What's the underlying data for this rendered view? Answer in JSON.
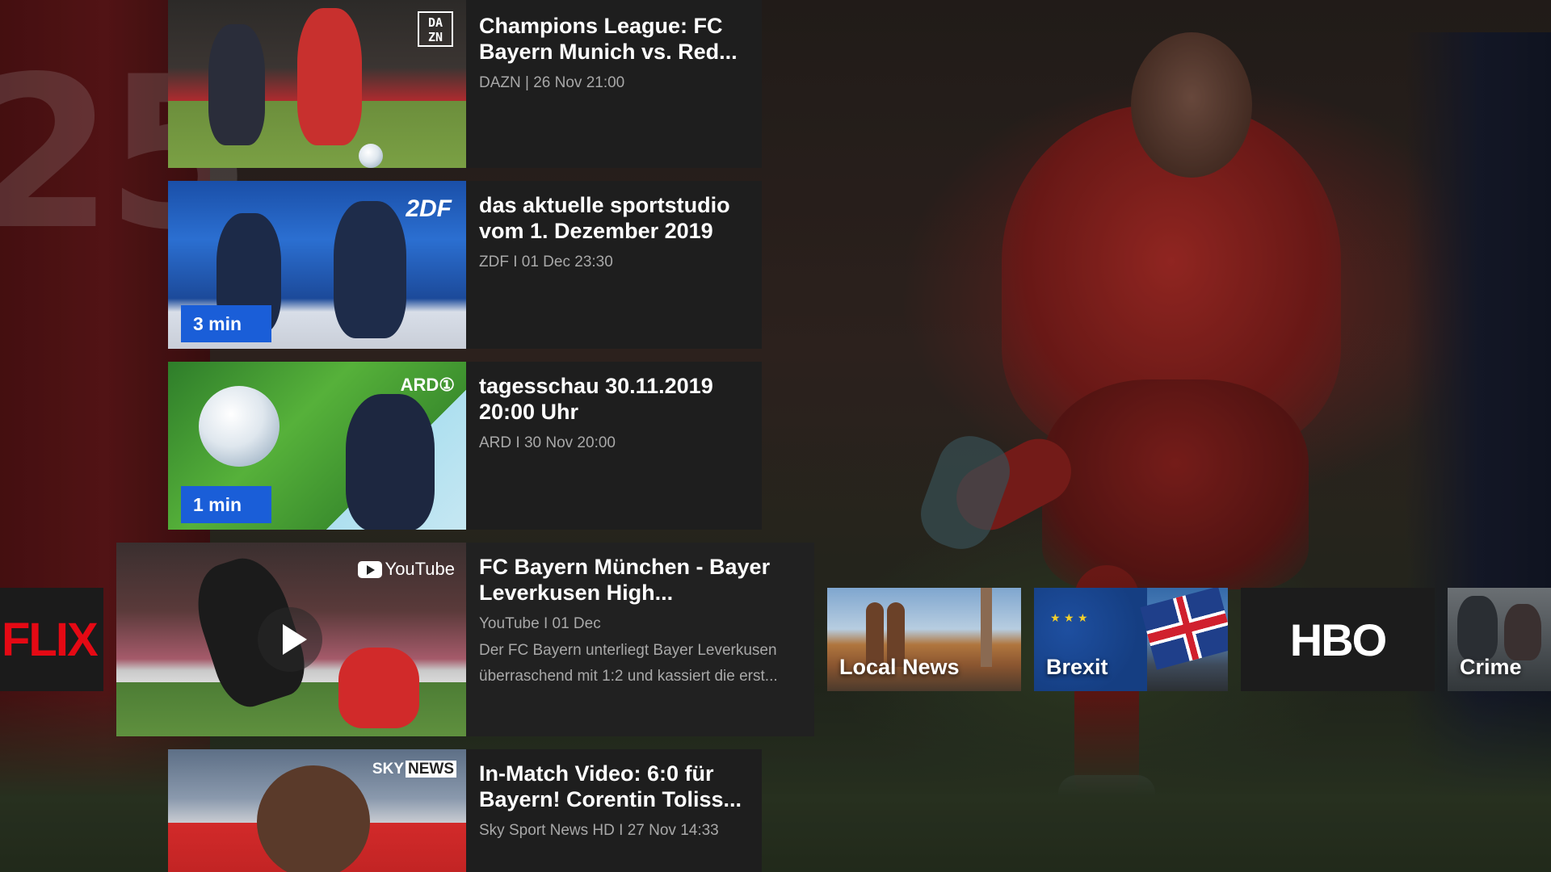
{
  "cards": [
    {
      "title": "Champions League: FC Bayern Munich vs. Red...",
      "meta": "DAZN | 26 Nov 21:00",
      "logo_lines": [
        "DA",
        "ZN"
      ]
    },
    {
      "title": "das aktuelle sportstudio vom 1. Dezember 2019",
      "meta": "ZDF  I  01 Dec 23:30",
      "logo": "2DF",
      "duration": "3 min"
    },
    {
      "title": "tagesschau 30.11.2019 20:00 Uhr",
      "meta": "ARD  I  30 Nov 20:00",
      "logo": "ARD①",
      "duration": "1 min"
    },
    {
      "title": "FC Bayern München - Bayer Leverkusen High...",
      "meta": "YouTube  I  01 Dec",
      "description": "Der FC Bayern unterliegt Bayer Leverkusen überraschend mit 1:2 und kassiert die erst...",
      "logo": "YouTube"
    },
    {
      "title": "In-Match Video: 6:0 für Bayern! Corentin Toliss...",
      "meta": "Sky Sport News HD  I  27 Nov  14:33",
      "logo_sky": "SKY",
      "logo_news": "NEWS"
    }
  ],
  "row": {
    "netflix_label": "FLIX",
    "tiles": [
      {
        "label": "Local News"
      },
      {
        "label": "Brexit"
      },
      {
        "label": "HBO"
      },
      {
        "label": "Crime"
      }
    ]
  },
  "icons": {
    "play": "play-icon",
    "youtube": "youtube-logo-icon"
  },
  "colors": {
    "duration_badge": "#1a5ed8",
    "netflix_red": "#e50914",
    "card_bg": "#1e1e1e"
  }
}
